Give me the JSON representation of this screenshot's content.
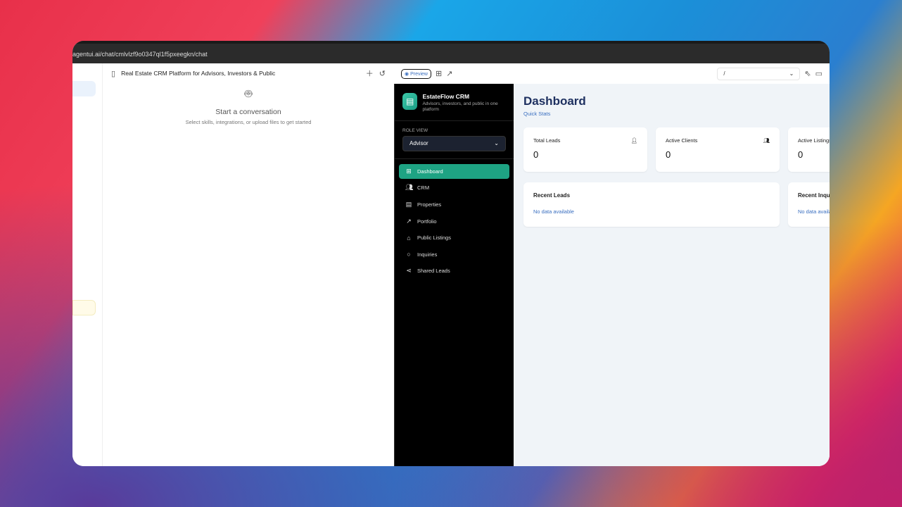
{
  "browser": {
    "url": "agentui.ai/chat/cmlvlzf9o0347ql1f5pxeegkn/chat"
  },
  "chat": {
    "title": "Real Estate CRM Platform for Advisors, Investors & Public",
    "empty_title": "Start a conversation",
    "empty_subtitle": "Select skills, integrations, or upload files to get started"
  },
  "preview": {
    "preview_label": "Preview",
    "route": "/"
  },
  "app": {
    "name": "EstateFlow CRM",
    "tagline": "Advisors, investors, and public in one platform",
    "role_label": "ROLE VIEW",
    "role_value": "Advisor",
    "nav": [
      {
        "label": "Dashboard",
        "icon": "grid-icon",
        "active": true
      },
      {
        "label": "CRM",
        "icon": "users-icon"
      },
      {
        "label": "Properties",
        "icon": "building-icon"
      },
      {
        "label": "Portfolio",
        "icon": "trending-up-icon"
      },
      {
        "label": "Public Listings",
        "icon": "home-icon"
      },
      {
        "label": "Inquiries",
        "icon": "message-icon"
      },
      {
        "label": "Shared Leads",
        "icon": "share-icon"
      }
    ]
  },
  "dashboard": {
    "title": "Dashboard",
    "subtitle": "Quick Stats",
    "stats": [
      {
        "label": "Total Leads",
        "value": "0"
      },
      {
        "label": "Active Clients",
        "value": "0"
      },
      {
        "label": "Active Listings",
        "value": "0"
      }
    ],
    "panels": [
      {
        "title": "Recent Leads",
        "empty": "No data available"
      },
      {
        "title": "Recent Inquiries",
        "empty": "No data available"
      }
    ]
  },
  "colors": {
    "accent": "#1ea383",
    "title": "#1e3060",
    "link": "#3a6fc0"
  }
}
